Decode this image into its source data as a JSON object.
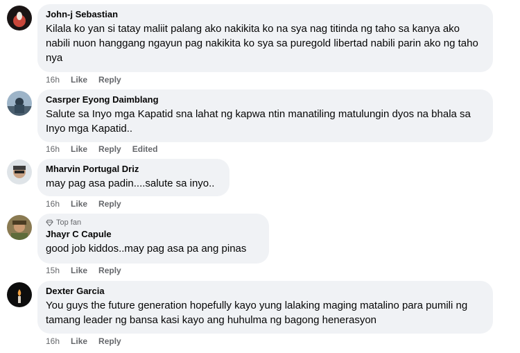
{
  "comments": [
    {
      "author": "John-j Sebastian",
      "text": "Kilala ko yan si tatay maliit palang ako nakikita ko na sya nag titinda ng taho sa kanya ako nabili nuon hanggang ngayun pag nakikita ko sya sa puregold libertad nabili parin ako ng taho nya",
      "time": "16h",
      "like": "Like",
      "reply": "Reply",
      "edited": ""
    },
    {
      "author": "Casrper Eyong Daimblang",
      "text": "Salute sa Inyo mga Kapatid sna lahat ng kapwa ntin manatiling matulungin dyos na bhala sa Inyo mga Kapatid..",
      "time": "16h",
      "like": "Like",
      "reply": "Reply",
      "edited": "Edited"
    },
    {
      "author": "Mharvin Portugal Driz",
      "text": "may pag asa padin....salute sa inyo..",
      "time": "16h",
      "like": "Like",
      "reply": "Reply",
      "edited": ""
    },
    {
      "badge": "Top fan",
      "author": "Jhayr C Capule",
      "text": "good job kiddos..may pag asa pa ang pinas",
      "time": "15h",
      "like": "Like",
      "reply": "Reply",
      "edited": ""
    },
    {
      "author": "Dexter Garcia",
      "text": "You guys the future generation hopefully kayo yung lalaking maging matalino para pumili ng tamang leader ng bansa kasi kayo ang huhulma ng bagong henerasyon",
      "time": "16h",
      "like": "Like",
      "reply": "Reply",
      "edited": ""
    }
  ]
}
